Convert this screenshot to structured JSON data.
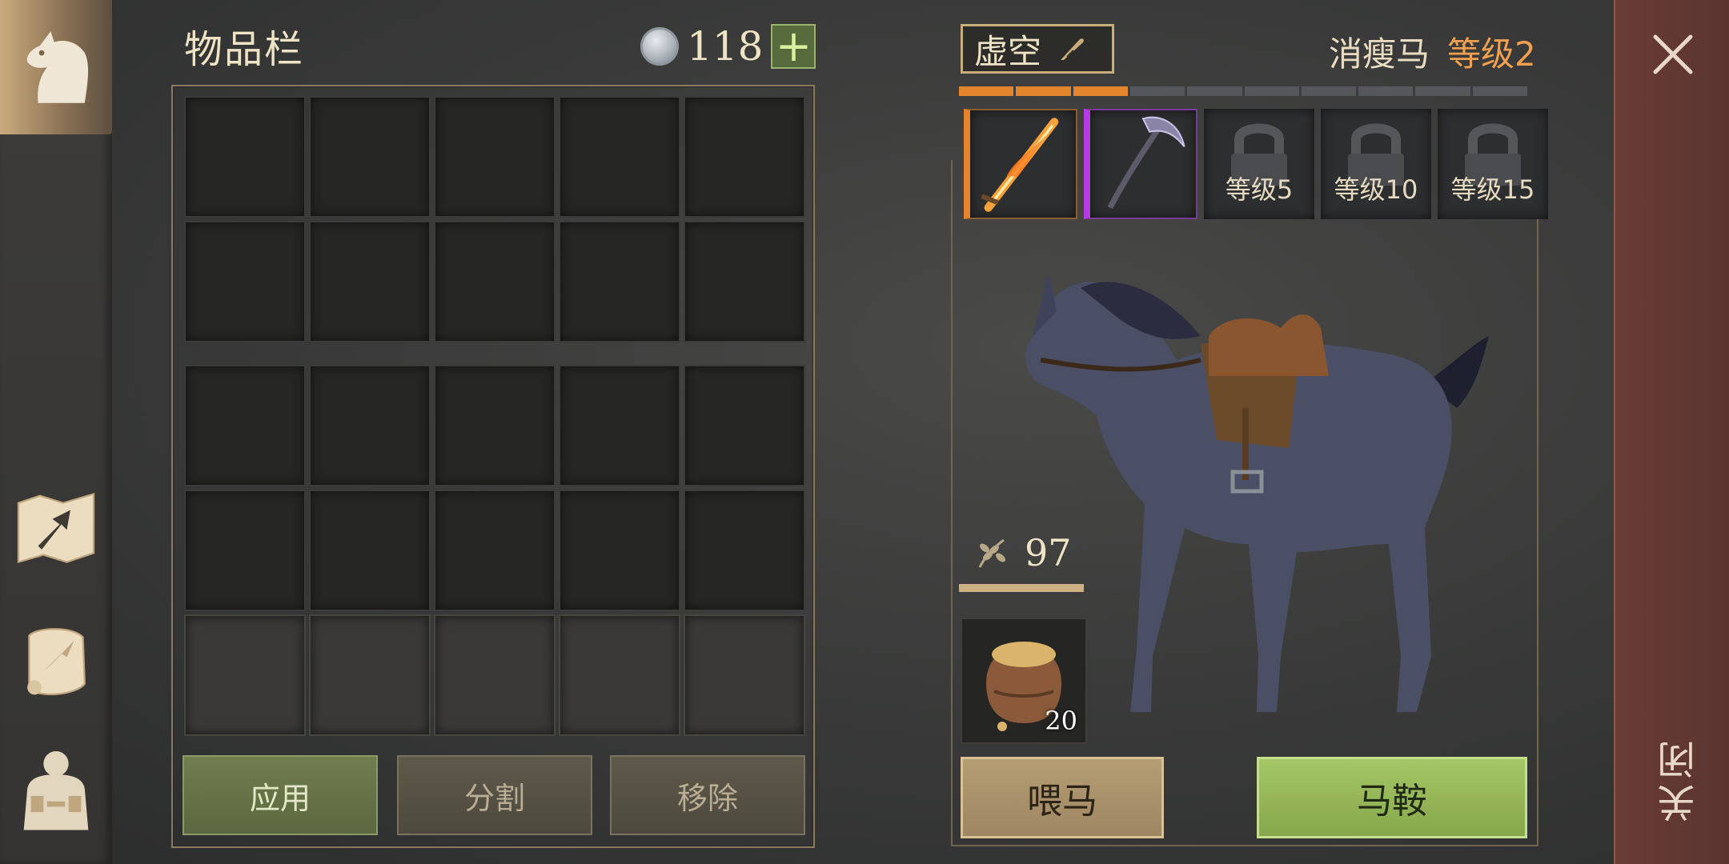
{
  "inventory": {
    "title": "物品栏",
    "currency_value": "118",
    "currency_icon": "silver-coin-icon",
    "apply_label": "应用",
    "split_label": "分割",
    "remove_label": "移除"
  },
  "mount": {
    "name": "虚空",
    "type": "消瘦马",
    "level": "等级2",
    "level_progress_segments_filled": 3,
    "level_progress_segments_total": 10,
    "equipment_slots": [
      {
        "item": "flaming-sword-icon",
        "rarity_color": "#e7832a"
      },
      {
        "item": "void-scythe-icon",
        "rarity_color": "#b33de0"
      },
      {
        "locked_label": "等级5"
      },
      {
        "locked_label": "等级10"
      },
      {
        "locked_label": "等级15"
      }
    ],
    "food_value": "97",
    "food_item_qty": "20",
    "feed_label": "喂马",
    "saddle_label": "马鞍"
  },
  "close": {
    "label": "关闭"
  },
  "colors": {
    "accent_orange": "#e2852d",
    "rarity_purple": "#b33de0",
    "button_green": "#a6c766",
    "close_strip": "#6a3c36"
  }
}
